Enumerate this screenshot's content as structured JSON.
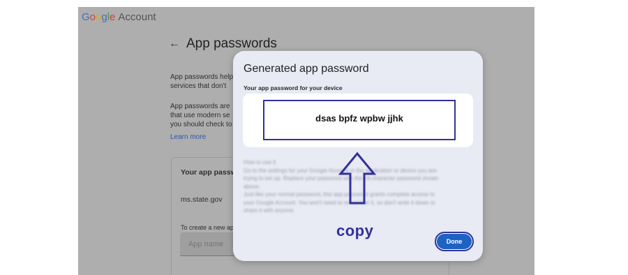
{
  "header": {
    "brand_google": [
      "G",
      "o",
      "o",
      "g",
      "l",
      "e"
    ],
    "brand_account": "Account"
  },
  "main": {
    "back_icon": "arrow-left-icon",
    "title": "App passwords",
    "para1": [
      "App passwords help",
      "services that don't"
    ],
    "para2": [
      "App passwords are",
      "that use modern se",
      "you should check to"
    ],
    "learn_more": "Learn more",
    "card": {
      "heading": "Your app passw",
      "account": "ms.state.gov",
      "create_hint": "To create a new ap",
      "app_name_placeholder": "App name"
    }
  },
  "dialog": {
    "title": "Generated app password",
    "password_label": "Your app password for your device",
    "password_value": "dsas bpfz wpbw jjhk",
    "howto_title": "How to use it",
    "howto_lines": [
      "Go to the settings for your Google Account in the application or device you are",
      "trying to set up. Replace your password with the 16-character password shown",
      "above.",
      "Just like your normal password, this app password grants complete access to",
      "your Google Account. You won't need to remember it, so don't write it down or",
      "share it with anyone."
    ],
    "annotation": "copy",
    "done_label": "Done"
  },
  "colors": {
    "annotation": "#31319a",
    "done_button": "#1e63c4",
    "dialog_bg": "#e8eaf4",
    "overlay_page": "#aeaeae"
  }
}
